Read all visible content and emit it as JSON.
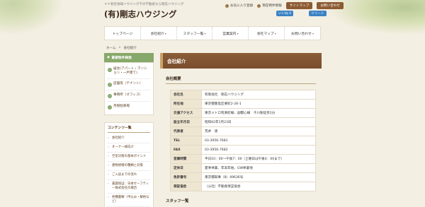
{
  "header": {
    "tagline": "＊＊各社地域ハウジング千の不動産なら剛志ハウジング",
    "logo": "(有)剛志ハウジング"
  },
  "toplinks": [
    {
      "label": "お気に入り登録",
      "icon": "star-icon"
    },
    {
      "label": "現在物件情報",
      "icon": "home-icon"
    }
  ],
  "topbuttons": {
    "sitemap": "サイトマップ",
    "contact": "お問い合わせ"
  },
  "social": {
    "like": "いいね 0",
    "tweet": "ツイート"
  },
  "nav": [
    "トップページ",
    "会社紹介",
    "スタッフ一覧",
    "営業案内",
    "会社マップ",
    "お問い合わせ"
  ],
  "breadcrumb": {
    "home": "ホーム",
    "sep": "»",
    "current": "会社紹介"
  },
  "sidebar": {
    "heading": "賃貸物件検索",
    "items": [
      "居住(アパート・マンション・一戸建て)",
      "店舗等（テナント）",
      "事務所（オフィス）",
      "月極駐車場"
    ]
  },
  "contents_menu": {
    "heading": "コンテンツ一覧",
    "items": [
      "会社紹介",
      "オーナー様向け",
      "空室対策の基本ポイント",
      "建物修繕の種類と対策",
      "ご入居までの流れ",
      "賃貸保証：日本セーフティー株式会社の場合",
      "各種書類（申込み・解約など）"
    ]
  },
  "main": {
    "title": "会社紹介",
    "section_title": "会社概要",
    "rows": [
      {
        "label": "会社名",
        "value": "有限会社　剛志ハウジング"
      },
      {
        "label": "所在地",
        "value": "東京都豊島区要町2-26-1"
      },
      {
        "label": "交通アクセス",
        "value": "東京メトロ有楽町線、副都心線　千川駅徒歩2分"
      },
      {
        "label": "設立年月日",
        "value": "昭和62年1月23日"
      },
      {
        "label": "代表者",
        "value": "荒井　達"
      },
      {
        "label": "TEL",
        "value": "03-3956-7681"
      },
      {
        "label": "FAX",
        "value": "03-3956-7682"
      },
      {
        "label": "営業時間",
        "value": "平日10：00〜午後7：00（土曜日は午後4：00まで）"
      },
      {
        "label": "定休日",
        "value": "夏季休業、年末年始、GW休業他"
      },
      {
        "label": "免許番号",
        "value": "東京都知事（8）49636号"
      },
      {
        "label": "保証協会",
        "value": "（公社）不動産保証協会"
      }
    ],
    "section_title2": "スタッフ一覧"
  }
}
